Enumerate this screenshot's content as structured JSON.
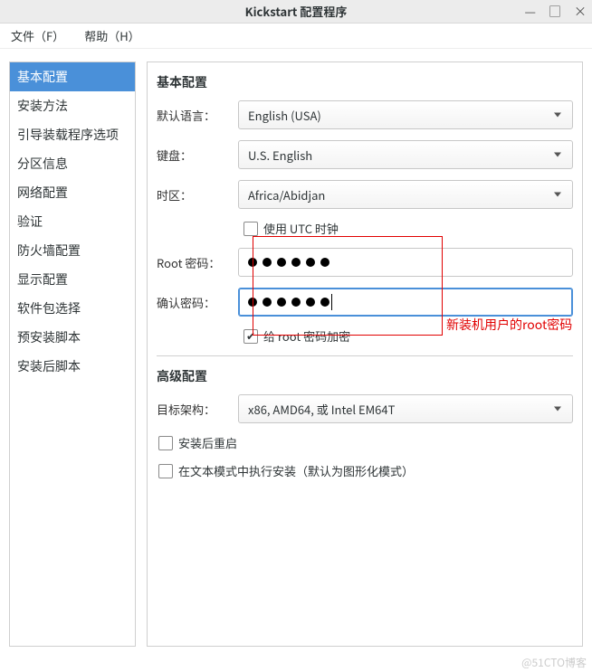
{
  "window": {
    "title": "Kickstart 配置程序",
    "min": "—",
    "max": "□",
    "close": "×"
  },
  "menu": {
    "file": "文件（F）",
    "help": "帮助（H）"
  },
  "sidebar": {
    "items": [
      "基本配置",
      "安装方法",
      "引导装载程序选项",
      "分区信息",
      "网络配置",
      "验证",
      "防火墙配置",
      "显示配置",
      "软件包选择",
      "预安装脚本",
      "安装后脚本"
    ],
    "selected_index": 0
  },
  "basic": {
    "title": "基本配置",
    "lang_label": "默认语言：",
    "lang_value": "English (USA)",
    "keyboard_label": "键盘：",
    "keyboard_value": "U.S. English",
    "tz_label": "时区：",
    "tz_value": "Africa/Abidjan",
    "utc_label": "使用  UTC 时钟",
    "utc_checked": false,
    "root_pw_label": "Root 密码：",
    "root_pw_dots": 6,
    "confirm_pw_label": "确认密码：",
    "confirm_pw_dots": 6,
    "encrypt_label": "给  root 密码加密",
    "encrypt_checked": true
  },
  "advanced": {
    "title": "高级配置",
    "arch_label": "目标架构：",
    "arch_value": "x86, AMD64, 或  Intel EM64T",
    "reboot_label": "安装后重启",
    "reboot_checked": false,
    "textmode_label": "在文本模式中执行安装（默认为图形化模式）",
    "textmode_checked": false
  },
  "annotation": {
    "text": "新装机用户的root密码"
  },
  "watermark": "@51CTO博客"
}
